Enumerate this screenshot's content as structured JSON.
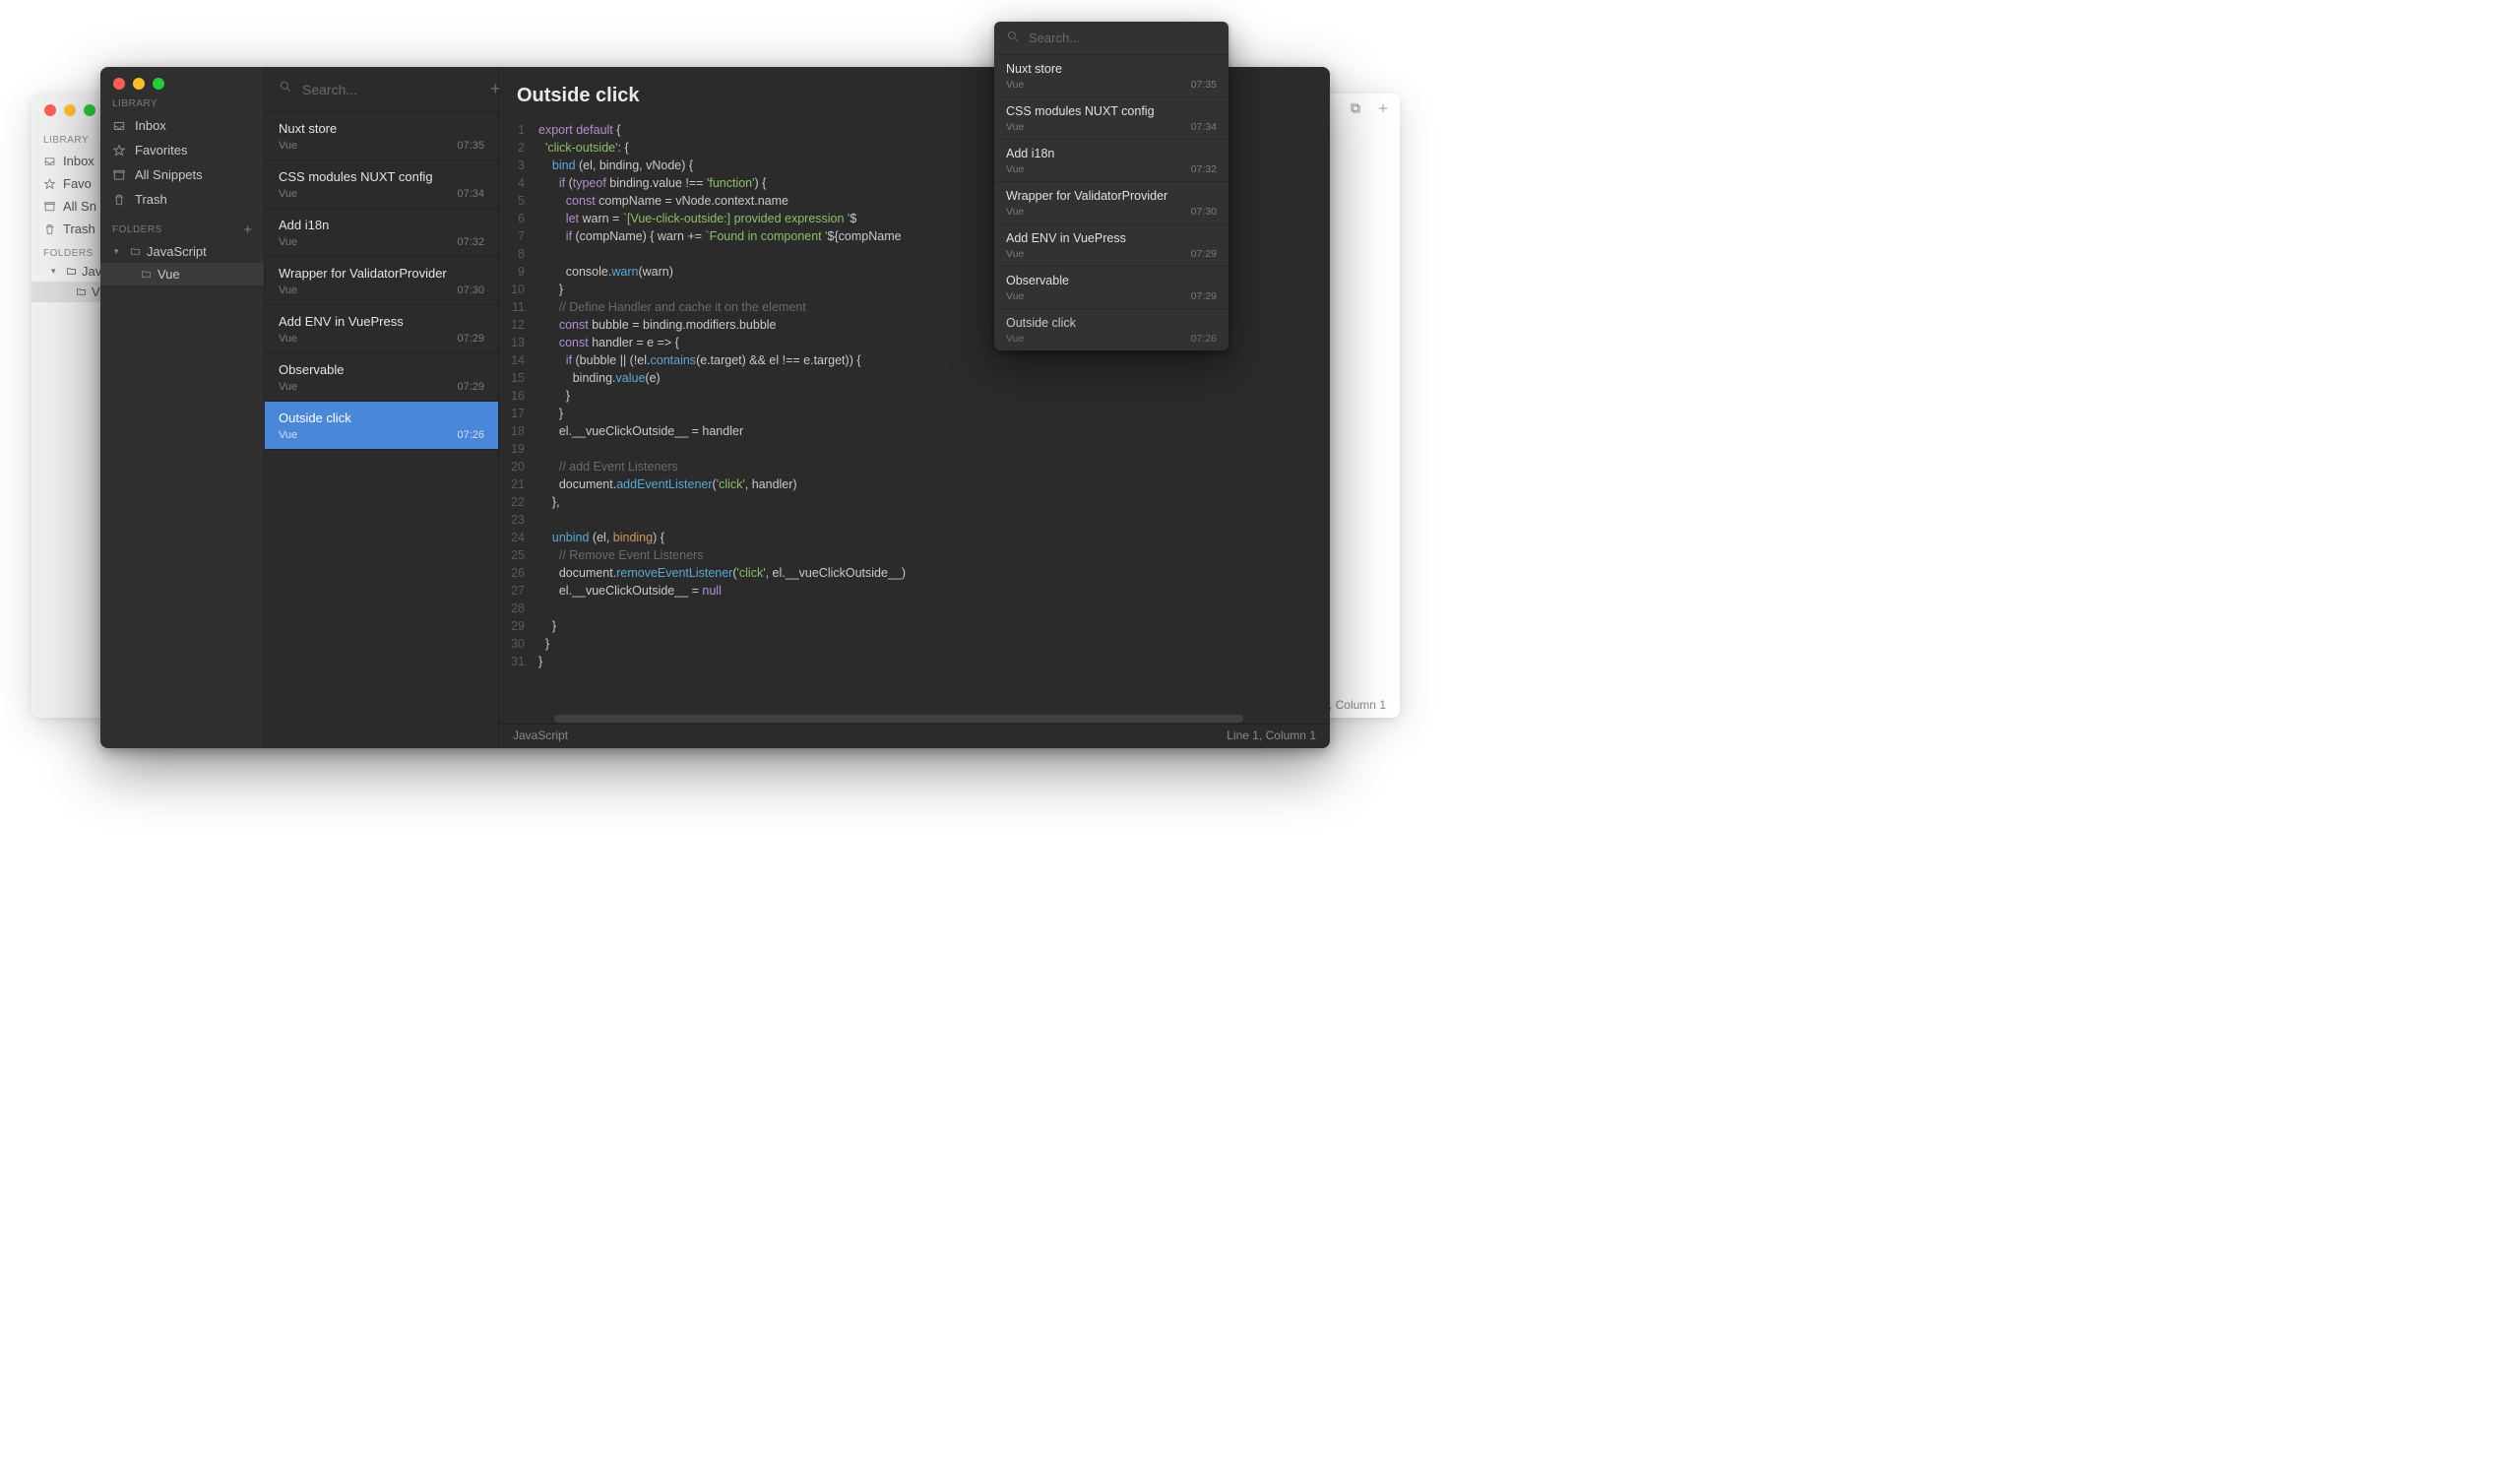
{
  "light": {
    "library_label": "LIBRARY",
    "inbox": "Inbox",
    "favorites": "Favo",
    "all_snippets": "All Sn",
    "trash": "Trash",
    "folders_label": "FOLDERS",
    "folder_js": "JavaS",
    "folder_vue": "Vue",
    "status": "e 1, Column 1"
  },
  "dark": {
    "library_label": "LIBRARY",
    "inbox": "Inbox",
    "favorites": "Favorites",
    "all_snippets": "All Snippets",
    "trash": "Trash",
    "folders_label": "FOLDERS",
    "folder_js": "JavaScript",
    "folder_vue": "Vue",
    "search_placeholder": "Search...",
    "snippets": [
      {
        "title": "Nuxt store",
        "tag": "Vue",
        "time": "07:35"
      },
      {
        "title": "CSS modules NUXT config",
        "tag": "Vue",
        "time": "07:34"
      },
      {
        "title": "Add i18n",
        "tag": "Vue",
        "time": "07:32"
      },
      {
        "title": "Wrapper for ValidatorProvider",
        "tag": "Vue",
        "time": "07:30"
      },
      {
        "title": "Add ENV in VuePress",
        "tag": "Vue",
        "time": "07:29"
      },
      {
        "title": "Observable",
        "tag": "Vue",
        "time": "07:29"
      },
      {
        "title": "Outside click",
        "tag": "Vue",
        "time": "07:26"
      }
    ],
    "selected_index": 6,
    "editor_title": "Outside click",
    "status_lang": "JavaScript",
    "status_pos": "Line 1, Column 1"
  },
  "popover": {
    "placeholder": "Search...",
    "items": [
      {
        "title": "Nuxt store",
        "tag": "Vue",
        "time": "07:35"
      },
      {
        "title": "CSS modules NUXT config",
        "tag": "Vue",
        "time": "07:34"
      },
      {
        "title": "Add i18n",
        "tag": "Vue",
        "time": "07:32"
      },
      {
        "title": "Wrapper for ValidatorProvider",
        "tag": "Vue",
        "time": "07:30"
      },
      {
        "title": "Add ENV in VuePress",
        "tag": "Vue",
        "time": "07:29"
      },
      {
        "title": "Observable",
        "tag": "Vue",
        "time": "07:29"
      },
      {
        "title": "Outside click",
        "tag": "Vue",
        "time": "07:26"
      }
    ]
  },
  "code_lines": [
    "<span class='tok-kw'>export</span> <span class='tok-kw'>default</span> {",
    "  <span class='tok-str'>'click-outside'</span>: {",
    "    <span class='tok-fn'>bind</span> (el, binding, vNode) {",
    "      <span class='tok-kw'>if</span> (<span class='tok-kw'>typeof</span> binding.value !== <span class='tok-str'>'function'</span>) {",
    "        <span class='tok-kw'>const</span> compName = vNode.context.name",
    "        <span class='tok-kw'>let</span> warn = <span class='tok-tmpl'>`[Vue-click-outside:] provided expression '</span>$",
    "        <span class='tok-kw'>if</span> (compName) { warn += <span class='tok-tmpl'>`Found in component '</span>${compName",
    "",
    "        console.<span class='tok-fn'>warn</span>(warn)",
    "      }",
    "      <span class='tok-cmt'>// Define Handler and cache it on the element</span>",
    "      <span class='tok-kw'>const</span> bubble = binding.modifiers.bubble",
    "      <span class='tok-kw'>const</span> handler = e =&gt; {",
    "        <span class='tok-kw'>if</span> (bubble || (!el.<span class='tok-fn'>contains</span>(e.target) &amp;&amp; el !== e.target)) {",
    "          binding.<span class='tok-fn'>value</span>(e)",
    "        }",
    "      }",
    "      el.__vueClickOutside__ = handler",
    "",
    "      <span class='tok-cmt'>// add Event Listeners</span>",
    "      document.<span class='tok-fn'>addEventListener</span>(<span class='tok-str'>'click'</span>, handler)",
    "    },",
    "",
    "    <span class='tok-fn'>unbind</span> (el, <span class='tok-prop'>binding</span>) {",
    "      <span class='tok-cmt'>// Remove Event Listeners</span>",
    "      document.<span class='tok-fn'>removeEventListener</span>(<span class='tok-str'>'click'</span>, el.__vueClickOutside__)",
    "      el.__vueClickOutside__ = <span class='tok-kw'>null</span>",
    "",
    "    }",
    "  }",
    "}"
  ]
}
